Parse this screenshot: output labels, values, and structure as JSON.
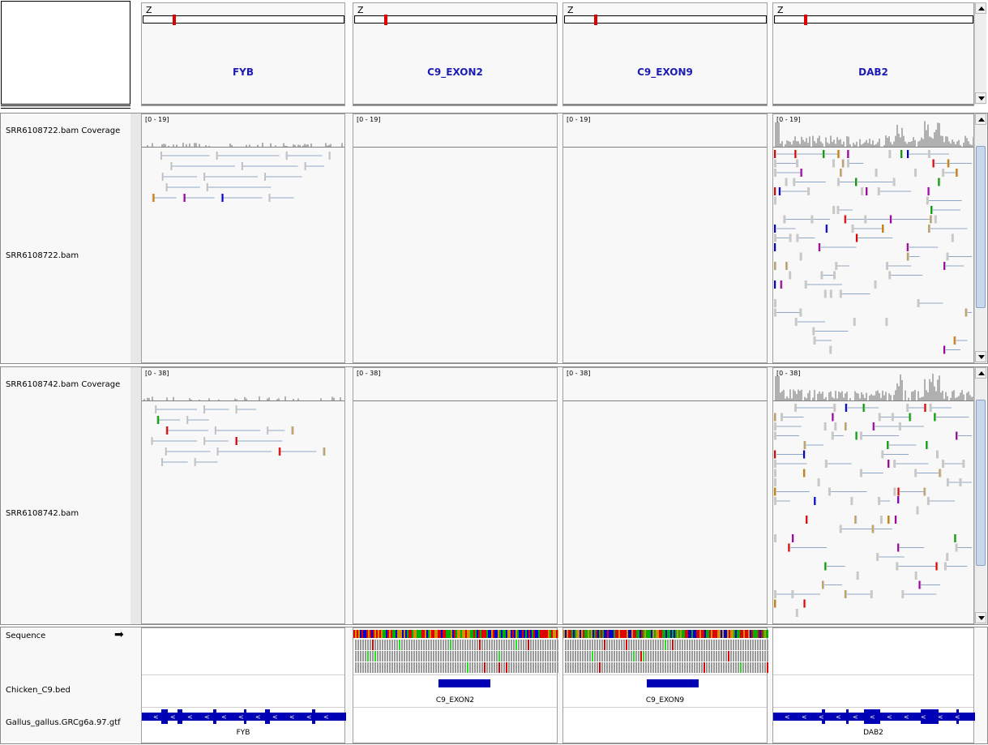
{
  "header": {
    "chromosome": "Z",
    "loci": [
      {
        "name": "FYB"
      },
      {
        "name": "C9_EXON2"
      },
      {
        "name": "C9_EXON9"
      },
      {
        "name": "DAB2"
      }
    ]
  },
  "tracks": {
    "sample1": {
      "coverage_label": "SRR6108722.bam Coverage",
      "alignment_label": "SRR6108722.bam",
      "range": "[0 - 19]"
    },
    "sample2": {
      "coverage_label": "SRR6108742.bam Coverage",
      "alignment_label": "SRR6108742.bam",
      "range": "[0 - 38]"
    },
    "annotations": {
      "sequence_label": "Sequence",
      "sequence_arrow": "➡",
      "bed_label": "Chicken_C9.bed",
      "gtf_label": "Gallus_gallus.GRCg6a.97.gtf",
      "bed_features": [
        "",
        "C9_EXON2",
        "C9_EXON9",
        ""
      ],
      "gtf_features": [
        "FYB",
        "",
        "",
        "DAB2"
      ]
    }
  },
  "colors": {
    "locus_title": "#1c1cb4",
    "feature_blue": "#0000b4",
    "coverage_gray": "#b0b0b0",
    "ideogram_marker": "#e00000"
  },
  "icons": {
    "scroll_up": "scroll-up-arrow-icon",
    "scroll_down": "scroll-down-arrow-icon",
    "strand": "strand-arrow-icon"
  }
}
